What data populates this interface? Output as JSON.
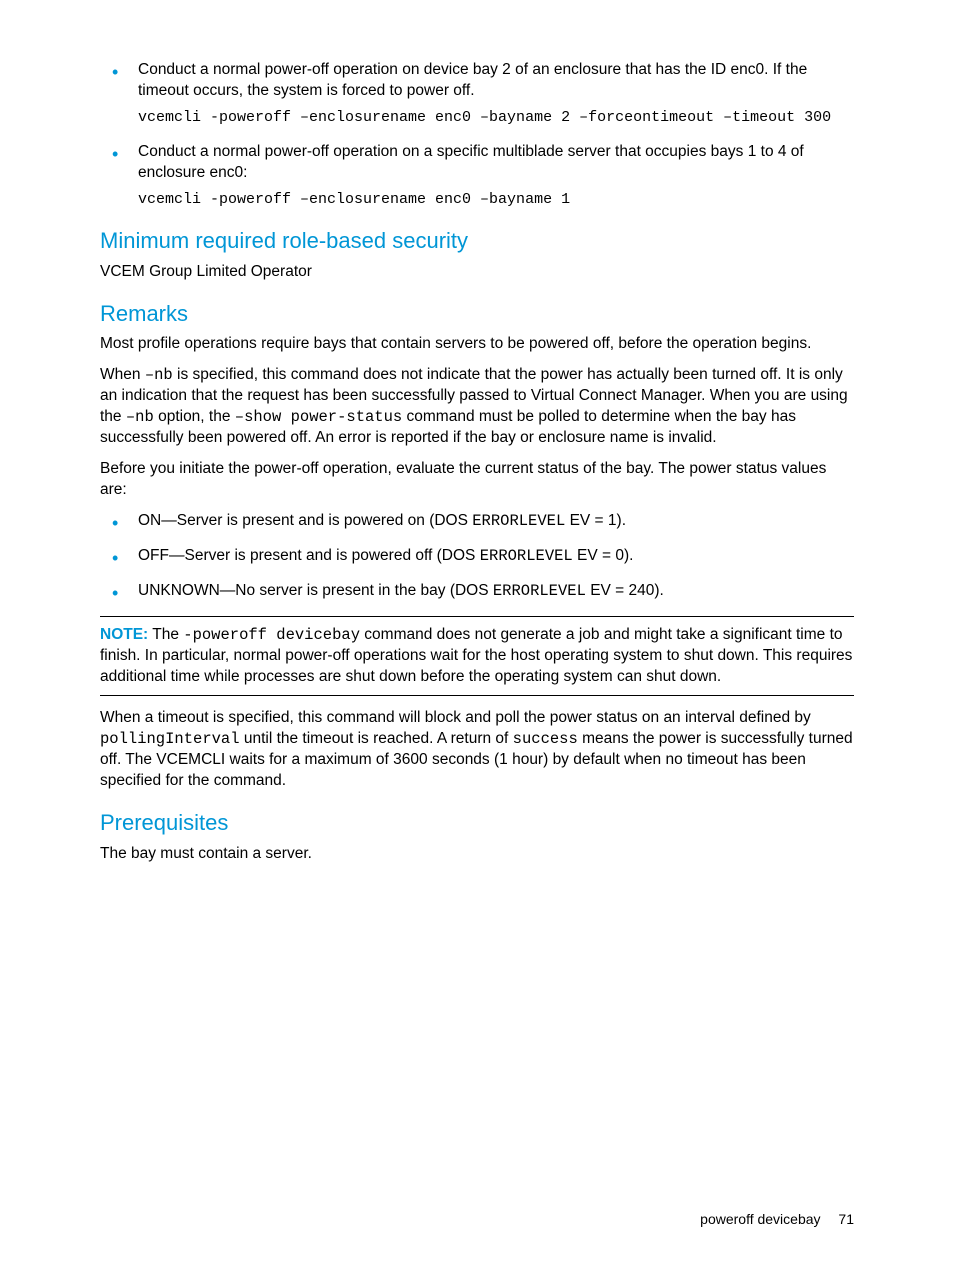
{
  "bullet1": {
    "text": "Conduct a normal power-off operation on device bay 2 of an enclosure that has the ID enc0. If the timeout occurs, the system is forced to power off.",
    "code": "vcemcli -poweroff –enclosurename enc0 –bayname 2 –forceontimeout –timeout 300"
  },
  "bullet2": {
    "text": "Conduct a normal power-off operation on a specific multiblade server that occupies bays 1 to 4 of enclosure enc0:",
    "code": "vcemcli -poweroff –enclosurename enc0 –bayname 1"
  },
  "sec1": {
    "heading": "Minimum required role-based security",
    "body": "VCEM Group Limited Operator"
  },
  "remarks": {
    "heading": "Remarks",
    "p1": "Most profile operations require bays that contain servers to be powered off, before the operation begins.",
    "p2a": "When ",
    "p2_nb": "–nb",
    "p2b": " is specified, this command does not indicate that the power has actually been turned off. It is only an indication that the request has been successfully passed to Virtual Connect Manager. When you are using the ",
    "p2_nb2": "–nb",
    "p2c": " option, the ",
    "p2_show": "–show power-status",
    "p2d": " command must be polled to determine when the bay has successfully been powered off. An error is reported if the bay or enclosure name is invalid.",
    "p3": "Before you initiate the power-off operation, evaluate the current status of the bay. The power status values are:",
    "status": {
      "on_a": "ON—Server is present and is powered on (DOS ",
      "on_code": "ERRORLEVEL",
      "on_b": " EV = 1).",
      "off_a": "OFF—Server is present and is powered off (DOS ",
      "off_code": "ERRORLEVEL",
      "off_b": " EV = 0).",
      "unk_a": "UNKNOWN—No server is present in the bay (DOS ",
      "unk_code": "ERRORLEVEL",
      "unk_b": " EV = 240)."
    }
  },
  "note": {
    "label": "NOTE:",
    "a": "   The ",
    "code": "-poweroff devicebay",
    "b": " command does not generate a job and might take a significant time to finish. In particular, normal power-off operations wait for the host operating system to shut down. This requires additional time while processes are shut down before the operating system can shut down."
  },
  "afternote": {
    "a": "When a timeout is specified, this command will block and poll the power status on an interval defined by ",
    "code1": "pollingInterval",
    "b": " until the timeout is reached. A return of ",
    "code2": "success",
    "c": " means the power is successfully turned off. The VCEMCLI waits for a maximum of 3600 seconds (1 hour) by default when no timeout has been specified for the command."
  },
  "prereq": {
    "heading": "Prerequisites",
    "body": "The bay must contain a server."
  },
  "footer": {
    "title": "poweroff devicebay",
    "page": "71"
  }
}
